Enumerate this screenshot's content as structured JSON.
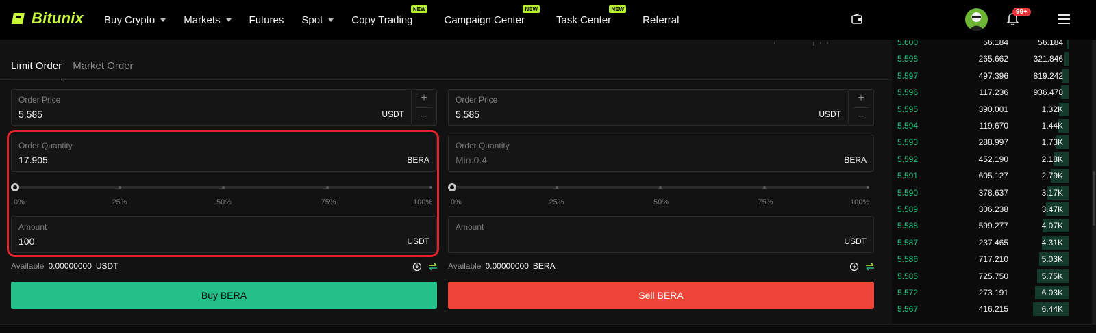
{
  "brand": {
    "name": "Bitunix",
    "accent": "#c8f73a"
  },
  "nav": {
    "items": [
      {
        "label": "Buy Crypto",
        "dropdown": true,
        "badge": ""
      },
      {
        "label": "Markets",
        "dropdown": true,
        "badge": ""
      },
      {
        "label": "Futures",
        "dropdown": false,
        "badge": ""
      },
      {
        "label": "Spot",
        "dropdown": true,
        "badge": ""
      },
      {
        "label": "Copy Trading",
        "dropdown": false,
        "badge": "NEW"
      },
      {
        "label": "Campaign Center",
        "dropdown": false,
        "badge": "NEW"
      },
      {
        "label": "Task Center",
        "dropdown": false,
        "badge": "NEW"
      },
      {
        "label": "Referral",
        "dropdown": false,
        "badge": ""
      }
    ],
    "notification_count": "99+"
  },
  "tabs": {
    "limit": "Limit Order",
    "market": "Market Order"
  },
  "buy": {
    "order_price_label": "Order Price",
    "order_price": "5.585",
    "price_unit": "USDT",
    "quantity_label": "Order Quantity",
    "quantity": "17.905",
    "quantity_unit": "BERA",
    "slider_labels": [
      "0%",
      "25%",
      "50%",
      "75%",
      "100%"
    ],
    "slider_level": 0,
    "amount_label": "Amount",
    "amount": "100",
    "amount_unit": "USDT",
    "available_label": "Available",
    "available_value": "0.00000000",
    "available_unit": "USDT",
    "button": "Buy BERA"
  },
  "sell": {
    "order_price_label": "Order Price",
    "order_price": "5.585",
    "price_unit": "USDT",
    "quantity_label": "Order Quantity",
    "quantity_placeholder": "Min.0.4",
    "quantity_unit": "BERA",
    "slider_labels": [
      "0%",
      "25%",
      "50%",
      "75%",
      "100%"
    ],
    "slider_level": 0,
    "amount_label": "Amount",
    "amount_unit": "USDT",
    "available_label": "Available",
    "available_value": "0.00000000",
    "available_unit": "BERA",
    "button": "Sell BERA"
  },
  "orderbook": {
    "rows": [
      {
        "price": "5.600",
        "qty": "56.184",
        "total": "56.184",
        "depth": 0.02
      },
      {
        "price": "5.598",
        "qty": "265.662",
        "total": "321.846",
        "depth": 0.04
      },
      {
        "price": "5.597",
        "qty": "497.396",
        "total": "819.242",
        "depth": 0.07
      },
      {
        "price": "5.596",
        "qty": "117.236",
        "total": "936.478",
        "depth": 0.08
      },
      {
        "price": "5.595",
        "qty": "390.001",
        "total": "1.32K",
        "depth": 0.1
      },
      {
        "price": "5.594",
        "qty": "119.670",
        "total": "1.44K",
        "depth": 0.11
      },
      {
        "price": "5.593",
        "qty": "288.997",
        "total": "1.73K",
        "depth": 0.13
      },
      {
        "price": "5.592",
        "qty": "452.190",
        "total": "2.18K",
        "depth": 0.16
      },
      {
        "price": "5.591",
        "qty": "605.127",
        "total": "2.79K",
        "depth": 0.19
      },
      {
        "price": "5.590",
        "qty": "378.637",
        "total": "3.17K",
        "depth": 0.22
      },
      {
        "price": "5.589",
        "qty": "306.238",
        "total": "3.47K",
        "depth": 0.24
      },
      {
        "price": "5.588",
        "qty": "599.277",
        "total": "4.07K",
        "depth": 0.27
      },
      {
        "price": "5.587",
        "qty": "237.465",
        "total": "4.31K",
        "depth": 0.28
      },
      {
        "price": "5.586",
        "qty": "717.210",
        "total": "5.03K",
        "depth": 0.31
      },
      {
        "price": "5.585",
        "qty": "725.750",
        "total": "5.75K",
        "depth": 0.33
      },
      {
        "price": "5.572",
        "qty": "273.191",
        "total": "6.03K",
        "depth": 0.35
      },
      {
        "price": "5.567",
        "qty": "416.215",
        "total": "6.44K",
        "depth": 0.37
      }
    ]
  },
  "colors": {
    "buy": "#23c089",
    "sell": "#ef4438",
    "highlight": "#e1242b"
  }
}
